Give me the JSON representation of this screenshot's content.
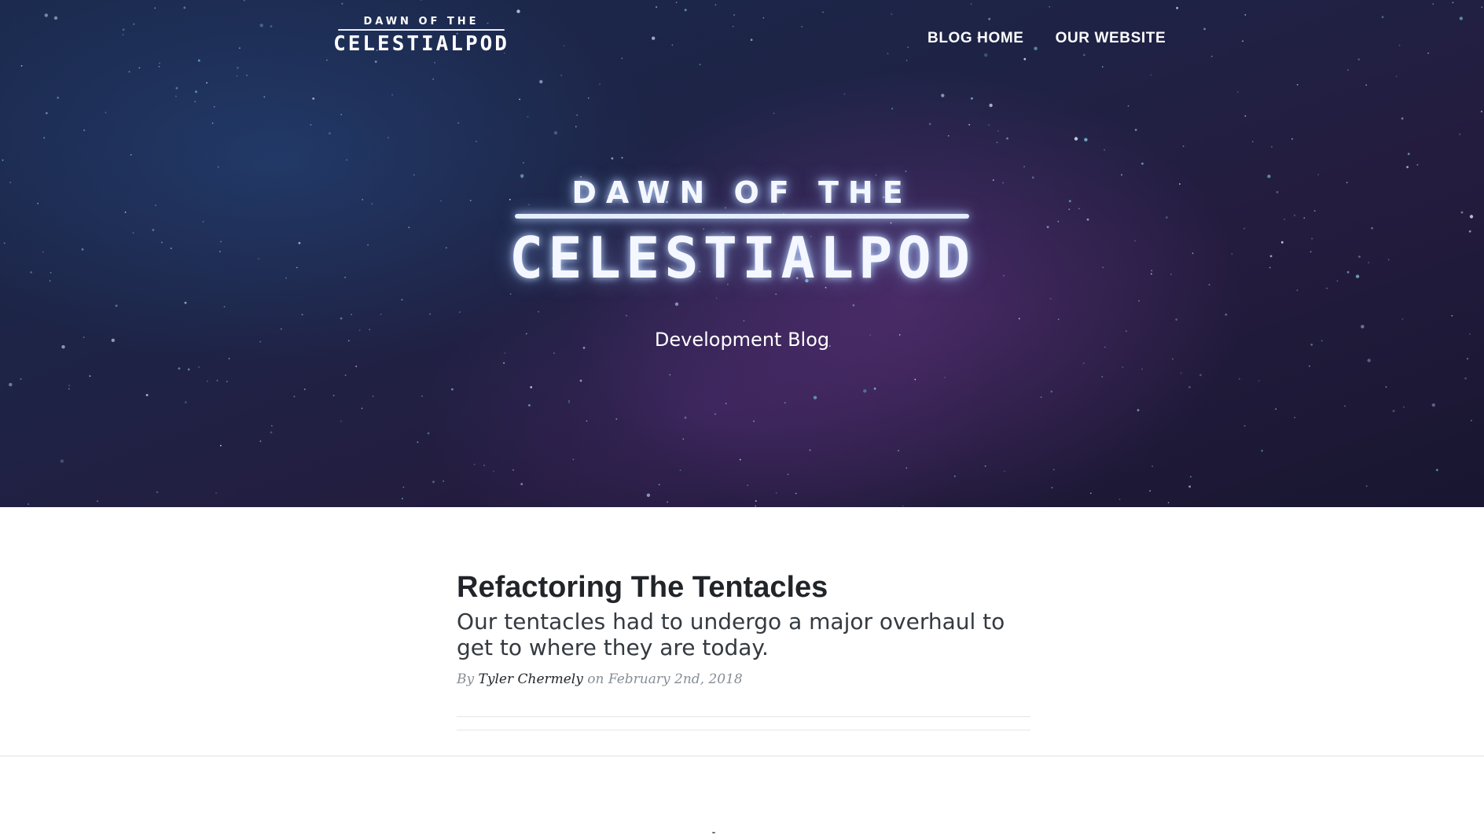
{
  "nav": {
    "logo": {
      "top_line": "DAWN OF THE",
      "main_line": "CELESTIALPOD"
    },
    "links": [
      "BLOG HOME",
      "OUR WEBSITE"
    ]
  },
  "hero": {
    "logo": {
      "top_line": "DAWN OF THE",
      "main_line": "CELESTIALPOD"
    },
    "subtitle": "Development Blog"
  },
  "post": {
    "title": "Refactoring The Tentacles",
    "subtitle": "Our tentacles had to undergo a major overhaul to get to where they are today.",
    "meta_by": "By",
    "author": "Tyler Chermely",
    "meta_on": "on",
    "date": "February 2nd, 2018"
  },
  "colors": {
    "hero_base": "#1d2446",
    "hero_purple": "#6e3c96",
    "text_dark": "#212529",
    "meta_gray": "#868e96"
  }
}
